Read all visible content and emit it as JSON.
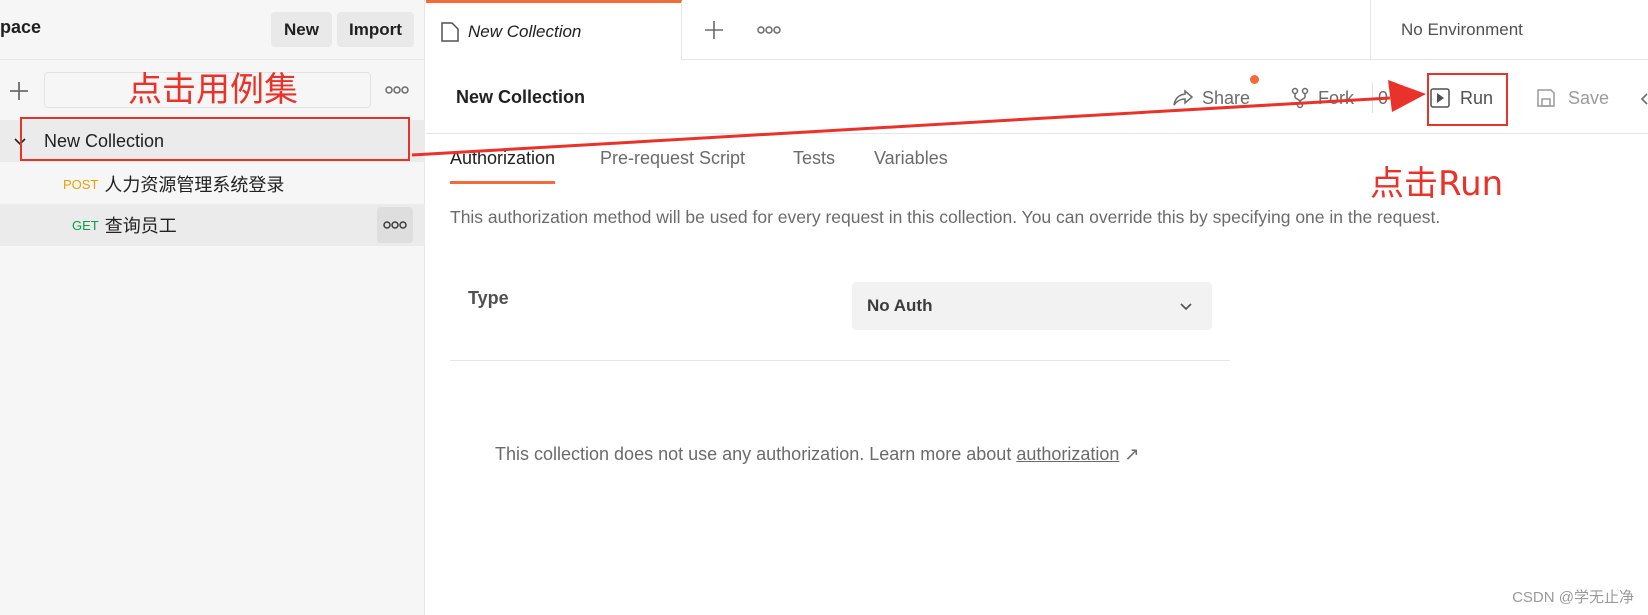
{
  "sidebar": {
    "workspace_name": "pace",
    "new_button": "New",
    "import_button": "Import",
    "collection": {
      "name": "New Collection"
    },
    "requests": [
      {
        "method": "POST",
        "method_color": "#e8a200",
        "name": "人力资源管理系统登录"
      },
      {
        "method": "GET",
        "method_color": "#0a9e4a",
        "name": "查询员工"
      }
    ]
  },
  "tabs": {
    "open_tab_label": "New Collection"
  },
  "environment": "No Environment",
  "collection_header": {
    "title": "New Collection",
    "share_label": "Share",
    "fork_label": "Fork",
    "fork_count": "0",
    "run_label": "Run",
    "save_label": "Save"
  },
  "content_tabs": [
    "Authorization",
    "Pre-request Script",
    "Tests",
    "Variables"
  ],
  "authorization": {
    "description": "This authorization method will be used for every request in this collection. You can override this by specifying one in the request.",
    "type_label": "Type",
    "type_value": "No Auth",
    "empty_message": "This collection does not use any authorization. Learn more about",
    "learn_link": "authorization",
    "link_arrow": "↗"
  },
  "annotations": {
    "click_collection": "点击用例集",
    "click_run": "点击Run",
    "color": "#e8322a"
  },
  "watermark": "CSDN @学无止净",
  "colors": {
    "accent": "#f26b3a"
  }
}
